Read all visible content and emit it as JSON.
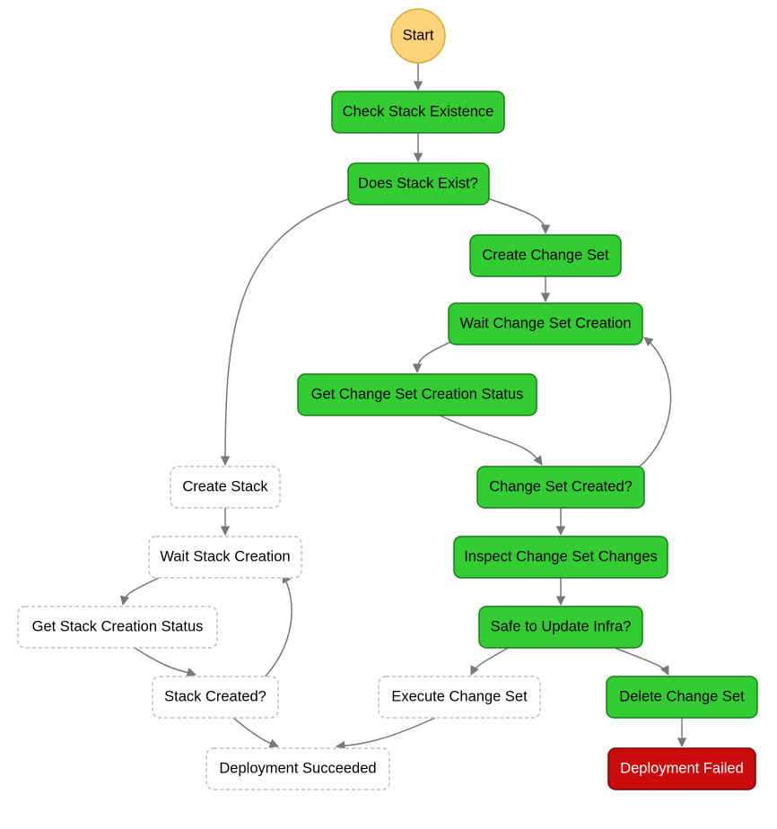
{
  "start": "Start",
  "nodes": {
    "check_stack": "Check Stack Existence",
    "does_stack_exist": "Does Stack Exist?",
    "create_change_set": "Create Change Set",
    "wait_change_set": "Wait Change Set Creation",
    "get_change_set_status": "Get Change Set Creation Status",
    "change_set_created": "Change Set Created?",
    "inspect_changes": "Inspect Change Set Changes",
    "safe_to_update": "Safe to Update Infra?",
    "delete_change_set": "Delete Change Set",
    "deployment_failed": "Deployment Failed",
    "create_stack": "Create Stack",
    "wait_stack_creation": "Wait Stack Creation",
    "get_stack_status": "Get Stack Creation Status",
    "stack_created": "Stack Created?",
    "execute_change_set": "Execute Change Set",
    "deployment_succeeded": "Deployment Succeeded"
  }
}
